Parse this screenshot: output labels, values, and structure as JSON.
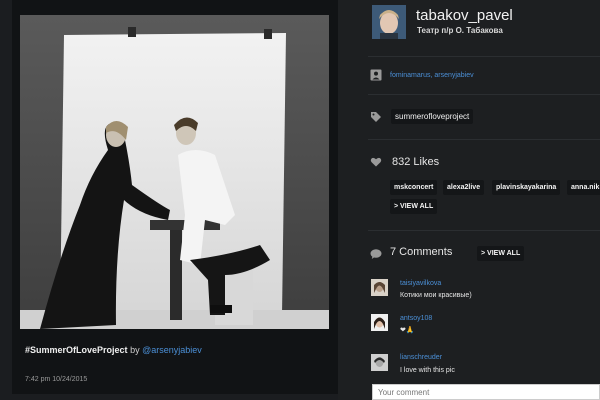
{
  "post": {
    "caption_hashtag": "#SummerOfLoveProject",
    "caption_by": "by",
    "caption_mention": "@arsenyjabiev",
    "timestamp": "7:42 pm 10/24/2015"
  },
  "profile": {
    "username": "tabakov_pavel",
    "subtitle": "Театр п/р О. Табакова"
  },
  "tagged": {
    "users_text": "fominamarus, arsenyjabiev"
  },
  "hashtags": [
    "summerofloveproject"
  ],
  "likes": {
    "count_label": "832 Likes",
    "likers": [
      "mskconcert",
      "alexa2live",
      "plavinskayakarina",
      "anna.nik"
    ],
    "view_all_label": "> VIEW ALL"
  },
  "comments": {
    "count_label": "7 Comments",
    "view_all_label": "> VIEW ALL",
    "items": [
      {
        "author": "taisiyavilkova",
        "text": "Котики мои красивые)"
      },
      {
        "author": "antsoy108",
        "text": "❤🙏"
      },
      {
        "author": "lianschreuder",
        "text": "I love with this pic"
      }
    ],
    "input_placeholder": "Your comment"
  },
  "colors": {
    "link": "#4b8fd6",
    "panel": "#1d1f21",
    "pill": "#141618"
  },
  "icons": {
    "tagged": "person-tag-icon",
    "hashtag": "tag-icon",
    "likes": "heart-icon",
    "comments": "speech-bubble-icon"
  }
}
